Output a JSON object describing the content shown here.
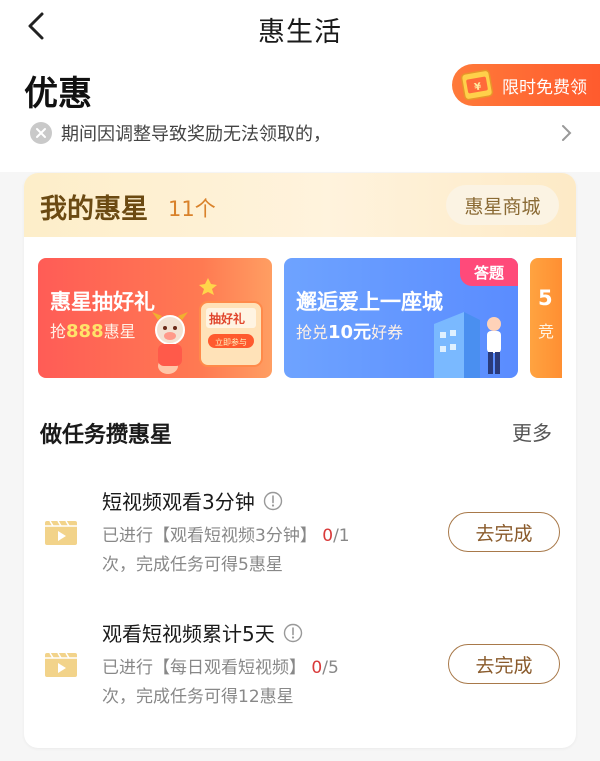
{
  "topbar": {
    "title": "惠生活"
  },
  "section": {
    "title": "优惠"
  },
  "promo": {
    "label": "限时免费领"
  },
  "notice": {
    "text": "期间因调整导致奖励无法领取的，"
  },
  "stars": {
    "title": "我的惠星",
    "count": "11个",
    "mall_label": "惠星商城"
  },
  "banners": [
    {
      "title": "惠星抽好礼",
      "sub_prefix": "抢",
      "sub_value": "888",
      "sub_suffix": "惠星",
      "art_text_1": "抽好礼",
      "art_text_2": "立即参与"
    },
    {
      "title": "邂逅爱上一座城",
      "sub_prefix": "抢兑",
      "sub_value": "10元",
      "sub_suffix": "好券",
      "tag": "答题"
    },
    {
      "title": "5",
      "sub": "竞"
    }
  ],
  "tasks": {
    "title": "做任务攒惠星",
    "more": "更多",
    "items": [
      {
        "name": "短视频观看3分钟",
        "desc_prefix": "已进行【观看短视频3分钟】 ",
        "done": "0",
        "total": "/1",
        "desc_suffix": "次，完成任务可得5惠星",
        "button": "去完成"
      },
      {
        "name": "观看短视频累计5天",
        "desc_prefix": "已进行【每日观看短视频】 ",
        "done": "0",
        "total": "/5",
        "desc_suffix": "次，完成任务可得12惠星",
        "button": "去完成"
      }
    ]
  },
  "colors": {
    "accent_orange": "#ff5b2e",
    "star_brown": "#6b4a12",
    "count_orange": "#d9822b",
    "progress_red": "#d93a3a",
    "button_border": "#a8794a"
  },
  "icons": [
    "chevron-left-icon",
    "gift-icon",
    "close-circle-icon",
    "chevron-right-icon",
    "video-icon",
    "info-icon"
  ]
}
